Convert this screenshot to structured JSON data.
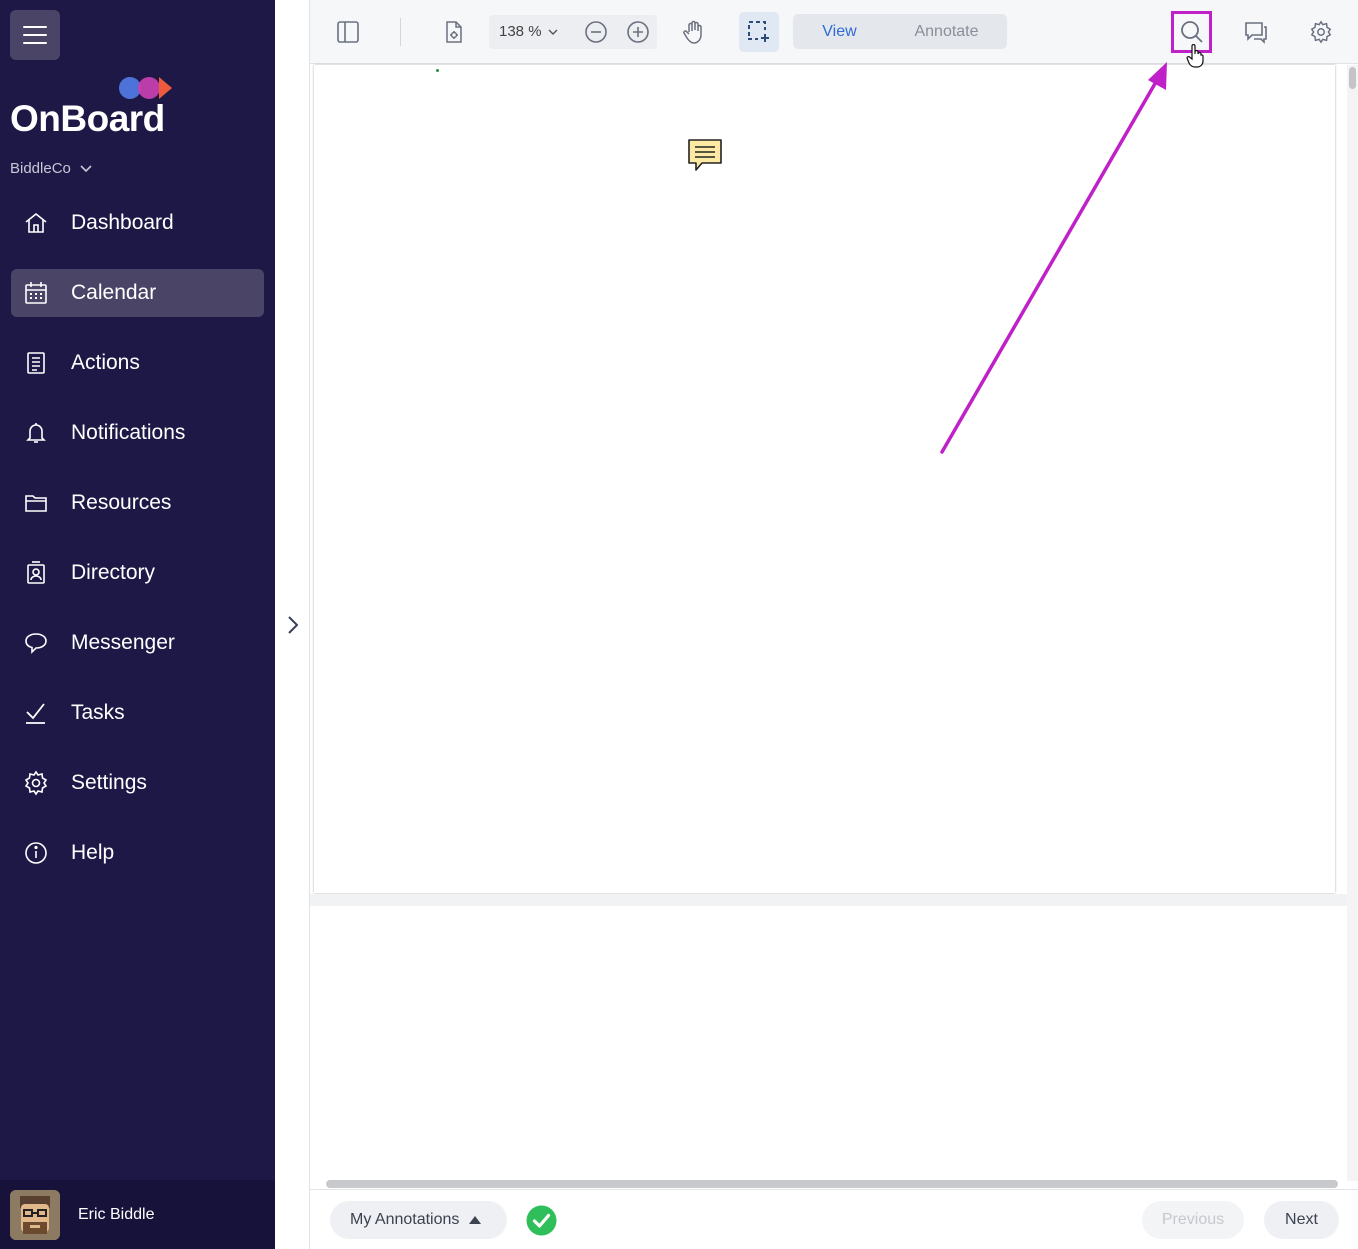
{
  "brand": {
    "name": "OnBoard",
    "dot_colors": [
      "#4e73d8",
      "#c43fb0",
      "#ef5a3c"
    ]
  },
  "org": {
    "name": "BiddleCo"
  },
  "nav": [
    {
      "label": "Dashboard",
      "icon": "home-icon"
    },
    {
      "label": "Calendar",
      "icon": "calendar-icon",
      "active": true
    },
    {
      "label": "Actions",
      "icon": "actions-icon"
    },
    {
      "label": "Notifications",
      "icon": "bell-icon"
    },
    {
      "label": "Resources",
      "icon": "folder-icon"
    },
    {
      "label": "Directory",
      "icon": "directory-icon"
    },
    {
      "label": "Messenger",
      "icon": "chat-icon"
    },
    {
      "label": "Tasks",
      "icon": "check-icon"
    },
    {
      "label": "Settings",
      "icon": "gear-icon"
    },
    {
      "label": "Help",
      "icon": "info-icon"
    }
  ],
  "user": {
    "name": "Eric Biddle"
  },
  "toolbar": {
    "zoom": "138 %",
    "modes": {
      "view": "View",
      "annotate": "Annotate",
      "active": "view"
    }
  },
  "footer": {
    "my_annotations": "My Annotations",
    "previous": "Previous",
    "next": "Next"
  },
  "colors": {
    "sidebar_bg": "#1e1846",
    "sidebar_active": "#4a4566",
    "highlight": "#c020c8",
    "accent": "#2f6bd6",
    "success": "#2fbf5a"
  }
}
